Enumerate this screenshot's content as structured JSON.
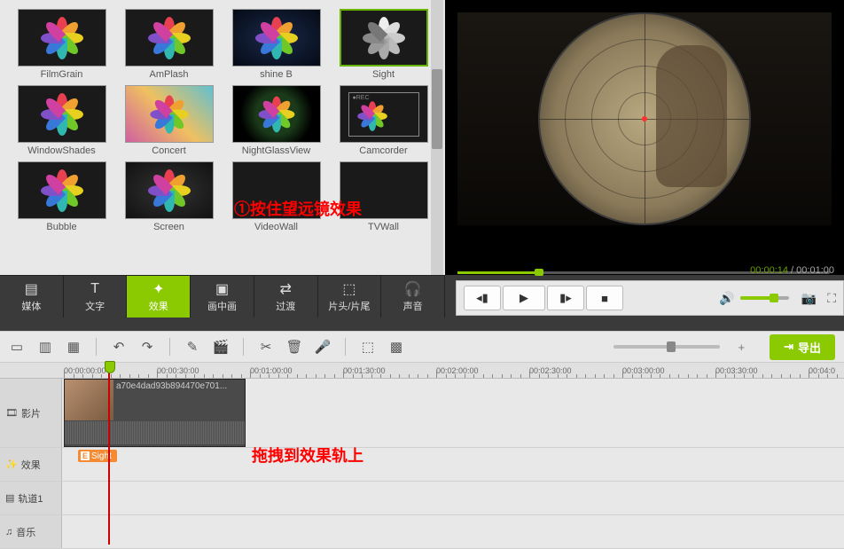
{
  "effects": [
    {
      "label": "FilmGrain",
      "kind": "flower-dark"
    },
    {
      "label": "AmPlash",
      "kind": "flower-dark"
    },
    {
      "label": "shine B",
      "kind": "flower-blue"
    },
    {
      "label": "Sight",
      "kind": "flower-grey",
      "selected": true
    },
    {
      "label": "WindowShades",
      "kind": "flower-dark"
    },
    {
      "label": "Concert",
      "kind": "concert"
    },
    {
      "label": "NightGlassView",
      "kind": "flower-green"
    },
    {
      "label": "Camcorder",
      "kind": "camcorder"
    },
    {
      "label": "Bubble",
      "kind": "flower-dark"
    },
    {
      "label": "Screen",
      "kind": "flower-fine"
    },
    {
      "label": "VideoWall",
      "kind": "videowall"
    },
    {
      "label": "TVWall",
      "kind": "tvwall"
    }
  ],
  "annotation1": "①按住望远镜效果",
  "annotation2": "拖拽到效果轨上",
  "categories": [
    {
      "label": "媒体",
      "icon": "media"
    },
    {
      "label": "文字",
      "icon": "text"
    },
    {
      "label": "效果",
      "icon": "effect",
      "active": true
    },
    {
      "label": "画中画",
      "icon": "pip"
    },
    {
      "label": "过渡",
      "icon": "transition"
    },
    {
      "label": "片头/片尾",
      "icon": "intro"
    },
    {
      "label": "声音",
      "icon": "audio"
    }
  ],
  "player": {
    "time_current": "00:00:14",
    "time_total": "00:01:00",
    "volume_pct": 70,
    "progress_pct": 22
  },
  "export_label": "导出",
  "ruler": [
    "00:00:00:00",
    "00:00:30:00",
    "00:01:00:00",
    "00:01:30:00",
    "00:02:00:00",
    "00:02:30:00",
    "00:03:00:00",
    "00:03:30:00",
    "00:04:0"
  ],
  "tracks": [
    {
      "label": "影片",
      "icon": "film"
    },
    {
      "label": "效果",
      "icon": "wand"
    },
    {
      "label": "轨道1",
      "icon": "bars"
    },
    {
      "label": "音乐",
      "icon": "music"
    }
  ],
  "clip": {
    "name": "a70e4dad93b894470e701..."
  },
  "effect_clip": {
    "badge": "E",
    "label": "Sight"
  },
  "petal_colors": [
    "#e84050",
    "#f0a030",
    "#e8d020",
    "#70c828",
    "#30b8b0",
    "#3878d8",
    "#8050c8",
    "#d040a0"
  ],
  "petal_grey": [
    "#eee",
    "#ddd",
    "#ccc",
    "#bbb",
    "#aaa",
    "#999",
    "#888",
    "#777"
  ]
}
